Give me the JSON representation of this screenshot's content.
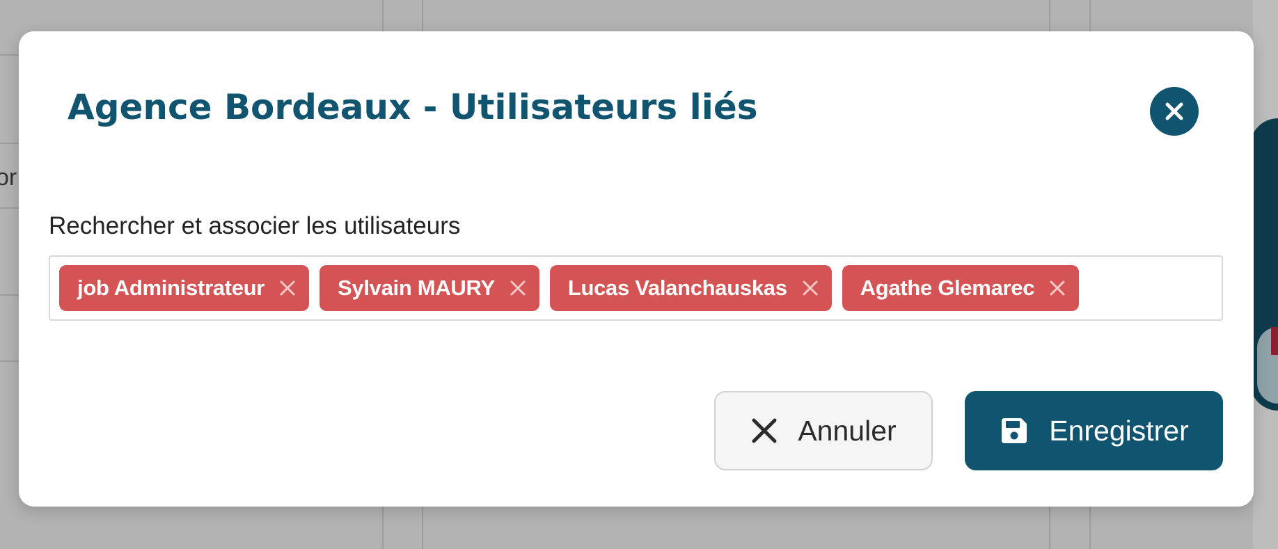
{
  "colors": {
    "primary": "#115470",
    "tag_bg": "#d45456",
    "overlay": "#b3b3b3",
    "cancel_bg": "#f5f5f5"
  },
  "background": {
    "fragment_text": "or"
  },
  "modal": {
    "title": "Agence Bordeaux - Utilisateurs liés",
    "close_icon": "close-icon",
    "field_label": "Rechercher et associer les utilisateurs",
    "tags": [
      {
        "label": "job Administrateur",
        "remove_icon": "x-icon"
      },
      {
        "label": "Sylvain MAURY",
        "remove_icon": "x-icon"
      },
      {
        "label": "Lucas Valanchauskas",
        "remove_icon": "x-icon"
      },
      {
        "label": "Agathe Glemarec",
        "remove_icon": "x-icon"
      }
    ],
    "cancel": {
      "label": "Annuler",
      "icon": "x-icon"
    },
    "save": {
      "label": "Enregistrer",
      "icon": "floppy-disk-icon"
    }
  }
}
